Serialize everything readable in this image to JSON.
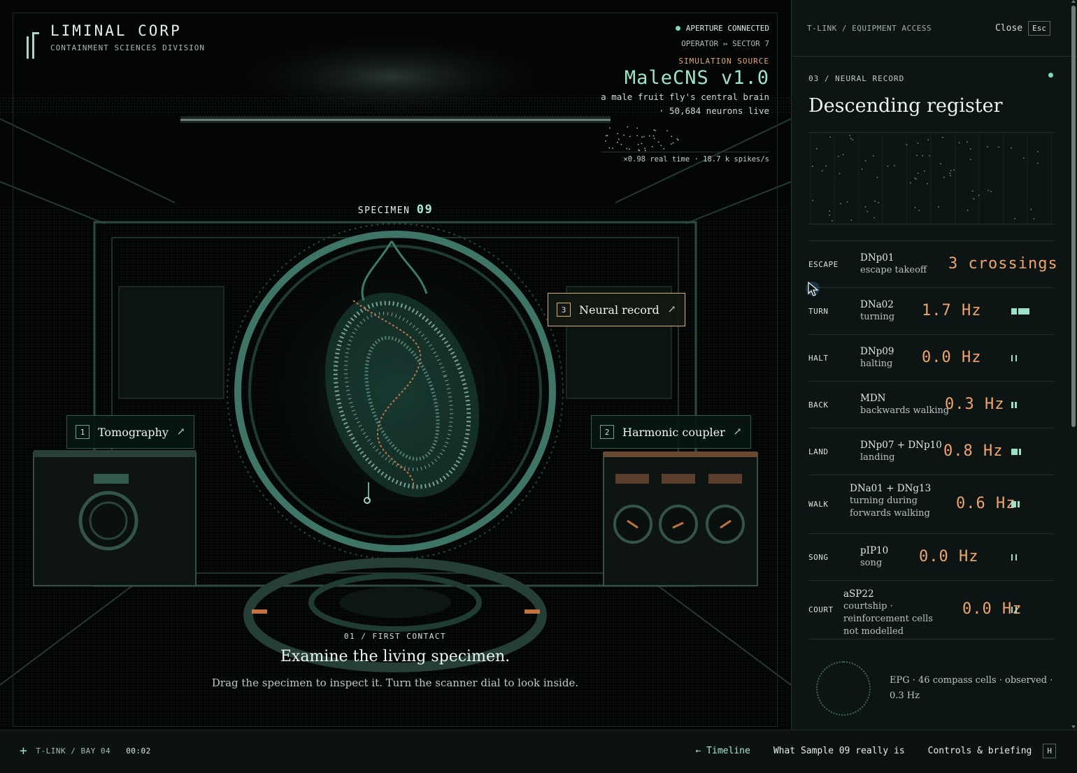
{
  "brand": {
    "title": "LIMINAL CORP",
    "subtitle": "CONTAINMENT SCIENCES DIVISION"
  },
  "hud": {
    "connection": "APERTURE CONNECTED",
    "operator": "OPERATOR ⇔ SECTOR 7",
    "source_label": "SIMULATION SOURCE",
    "model": "MaleCNS v1.0",
    "description": "a male fruit fly's central brain",
    "neurons": "· 50,684 neurons live",
    "rate": "×0.98 real time · 18.7 k spikes/s"
  },
  "specimen": {
    "label": "SPECIMEN",
    "number": "09"
  },
  "callouts": [
    {
      "num": "1",
      "label": "Tomography",
      "arrow": "↗"
    },
    {
      "num": "2",
      "label": "Harmonic coupler",
      "arrow": "↗"
    },
    {
      "num": "3",
      "label": "Neural record",
      "arrow": "↗"
    }
  ],
  "briefing": {
    "step": "01 / FIRST CONTACT",
    "headline": "Examine the living specimen.",
    "body": "Drag the specimen to inspect it. Turn the scanner dial to look inside."
  },
  "panel": {
    "crumb": "T-LINK / EQUIPMENT ACCESS",
    "close_label": "Close",
    "close_key": "Esc",
    "eyebrow": "03 / NEURAL RECORD",
    "title": "Descending register",
    "rows": [
      {
        "label": "ESCAPE",
        "neuron": "DNp01",
        "function": "escape takeoff",
        "value": "3 crossings",
        "level": 0
      },
      {
        "label": "TURN",
        "neuron": "DNa02",
        "function": "turning",
        "value": "1.7 Hz",
        "level": 0.85
      },
      {
        "label": "HALT",
        "neuron": "DNp09",
        "function": "halting",
        "value": "0.0 Hz",
        "level": 0
      },
      {
        "label": "BACK",
        "neuron": "MDN",
        "function": "backwards walking",
        "value": "0.3 Hz",
        "level": 0.15
      },
      {
        "label": "LAND",
        "neuron": "DNp07 + DNp10",
        "function": "landing",
        "value": "0.8 Hz",
        "level": 0.4
      },
      {
        "label": "WALK",
        "neuron": "DNa01 + DNg13",
        "function": "turning during forwards walking",
        "value": "0.6 Hz",
        "level": 0.3
      },
      {
        "label": "SONG",
        "neuron": "pIP10",
        "function": "song",
        "value": "0.0 Hz",
        "level": 0
      },
      {
        "label": "COURT",
        "neuron": "aSP22",
        "function": "courtship · reinforcement cells not modelled",
        "value": "0.0 Hz",
        "level": 0
      }
    ],
    "epg": "EPG · 46 compass cells · observed · 0.3 Hz"
  },
  "bottombar": {
    "station": "T-LINK / BAY 04",
    "clock": "00:02",
    "timeline": "← Timeline",
    "what_is": "What Sample 09 really is",
    "controls": "Controls & briefing",
    "controls_key": "H"
  },
  "colors": {
    "accent": "#9fe0c8",
    "value": "#f0a46e",
    "hot_border": "#d9b26e",
    "bg": "#060908"
  }
}
